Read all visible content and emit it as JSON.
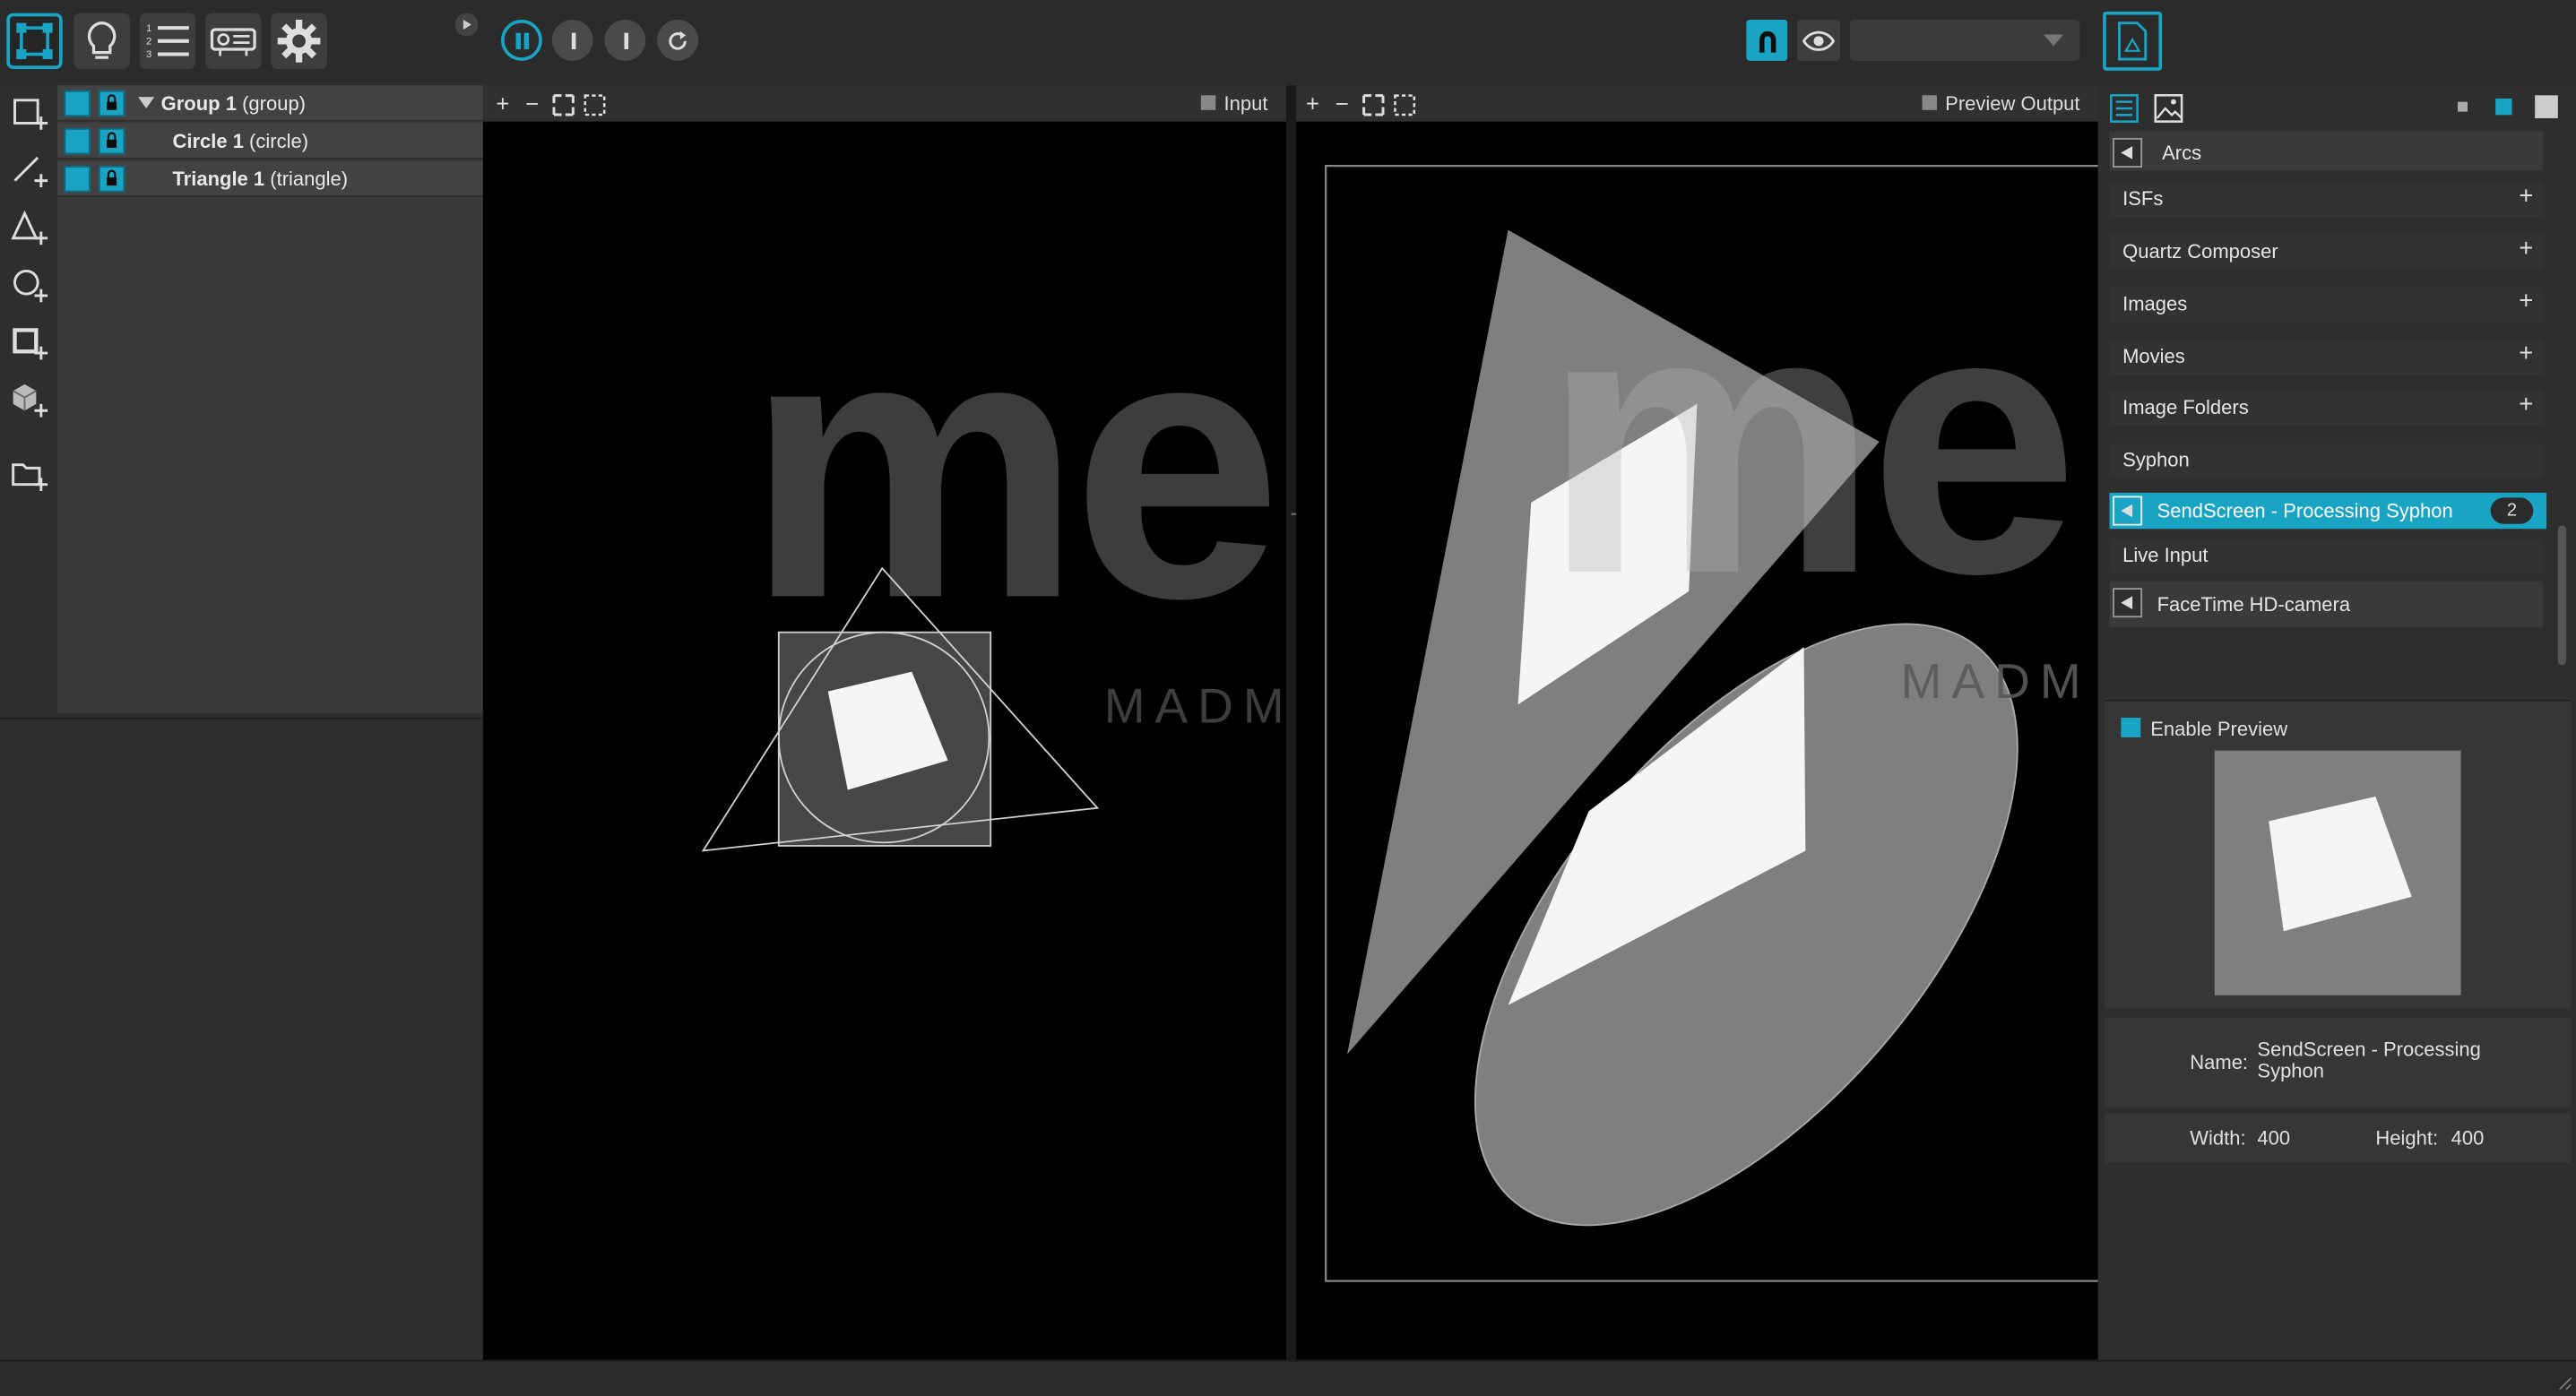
{
  "toolbar": {
    "dropdown_value": ""
  },
  "layers": {
    "items": [
      {
        "name": "Group 1",
        "type": "(group)"
      },
      {
        "name": "Circle 1",
        "type": "(circle)"
      },
      {
        "name": "Triangle 1",
        "type": "(triangle)"
      }
    ]
  },
  "input_panel": {
    "label": "Input"
  },
  "output_panel": {
    "label": "Preview Output"
  },
  "watermark": {
    "big": "me",
    "small": "MADM"
  },
  "sources": {
    "categories": [
      {
        "label": "Arcs"
      },
      {
        "label": "ISFs"
      },
      {
        "label": "Quartz Composer"
      },
      {
        "label": "Images"
      },
      {
        "label": "Movies"
      },
      {
        "label": "Image Folders"
      },
      {
        "label": "Syphon"
      },
      {
        "label": "SendScreen - Processing Syphon",
        "count": "2"
      },
      {
        "label": "Live Input"
      },
      {
        "label": "FaceTime HD-camera"
      }
    ]
  },
  "preview": {
    "enable_label": "Enable Preview"
  },
  "props": {
    "name_label": "Name:",
    "name_value": "SendScreen - Processing Syphon",
    "width_label": "Width:",
    "width_value": "400",
    "height_label": "Height:",
    "height_value": "400"
  },
  "colors": {
    "accent": "#19a4c4",
    "panel": "#3a3a3a",
    "canvas": "#000000"
  }
}
